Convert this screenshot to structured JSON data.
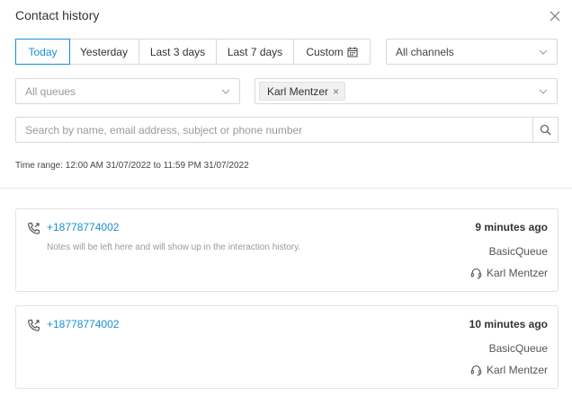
{
  "header": {
    "title": "Contact history"
  },
  "filters": {
    "range_buttons": {
      "today": "Today",
      "yesterday": "Yesterday",
      "last3": "Last 3 days",
      "last7": "Last 7 days",
      "custom": "Custom"
    },
    "active_range": "Today",
    "channels": {
      "placeholder": "All channels"
    },
    "queues": {
      "placeholder": "All queues"
    },
    "agents": {
      "selected_tag": "Karl Mentzer"
    },
    "search": {
      "placeholder": "Search by name, email address, subject or phone number"
    },
    "time_range": "Time range: 12:00 AM 31/07/2022 to 11:59 PM 31/07/2022"
  },
  "contacts": [
    {
      "number": "+18778774002",
      "notes": "Notes will be left here and will show up in the interaction history.",
      "time_ago": "9 minutes ago",
      "queue": "BasicQueue",
      "agent": "Karl Mentzer"
    },
    {
      "number": "+18778774002",
      "notes": "",
      "time_ago": "10 minutes ago",
      "queue": "BasicQueue",
      "agent": "Karl Mentzer"
    }
  ],
  "colors": {
    "accent": "#1a8fd6",
    "border": "#d9d9d9"
  },
  "icons": {
    "close": "close-icon",
    "calendar": "calendar-icon",
    "chevron": "chevron-down-icon",
    "search": "search-icon",
    "call": "outgoing-call-icon",
    "agent": "headset-icon"
  }
}
